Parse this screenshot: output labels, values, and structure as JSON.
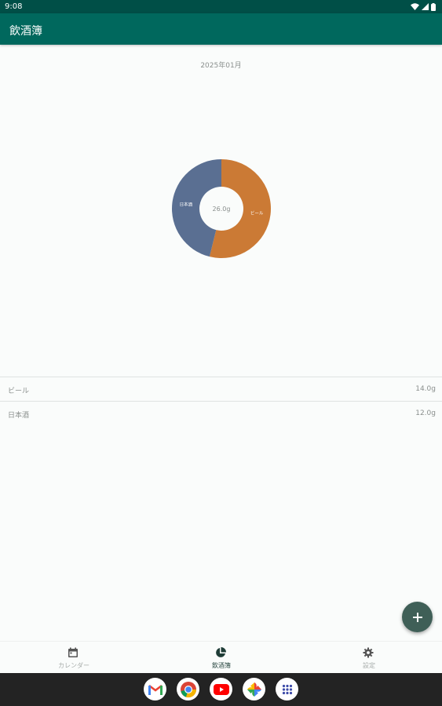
{
  "status_bar": {
    "time": "9:08"
  },
  "app_bar": {
    "title": "飲酒簿"
  },
  "month": "2025年01月",
  "chart_data": {
    "type": "pie",
    "categories": [
      "ビール",
      "日本酒"
    ],
    "values": [
      14.0,
      12.0
    ],
    "colors": [
      "#cb7a35",
      "#5a6f92"
    ],
    "center_label": "26.0g"
  },
  "rows": [
    {
      "name": "ビール",
      "amount": "14.0g"
    },
    {
      "name": "日本酒",
      "amount": "12.0g"
    }
  ],
  "bottom_nav": {
    "items": [
      {
        "label": "カレンダー",
        "icon": "calendar-icon"
      },
      {
        "label": "飲酒簿",
        "icon": "pie-chart-icon"
      },
      {
        "label": "設定",
        "icon": "gear-icon"
      }
    ],
    "active_index": 1
  },
  "dock": {
    "apps": [
      {
        "name": "gmail-icon"
      },
      {
        "name": "chrome-icon"
      },
      {
        "name": "youtube-icon"
      },
      {
        "name": "photos-icon"
      },
      {
        "name": "app-drawer-icon"
      }
    ]
  }
}
